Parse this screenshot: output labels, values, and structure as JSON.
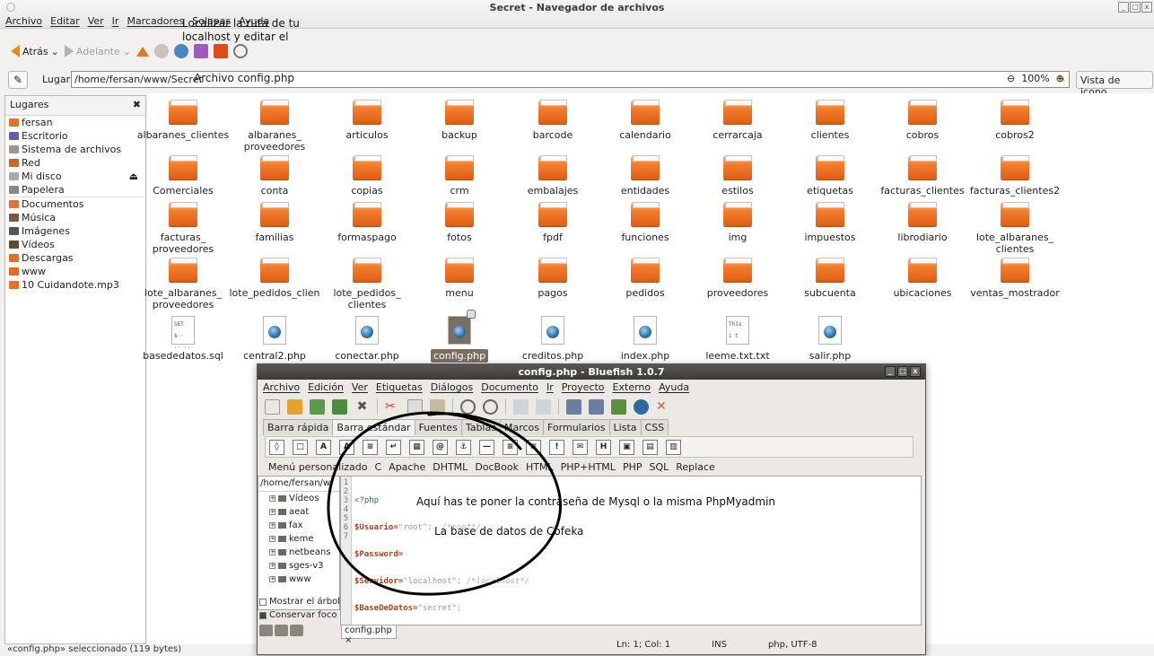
{
  "window": {
    "title": "Secret - Navegador de archivos"
  },
  "menu": [
    "Archivo",
    "Editar",
    "Ver",
    "Ir",
    "Marcadores",
    "Solapas",
    "Ayuda"
  ],
  "toolbar": {
    "back": "Atrás",
    "forward": "Adelante"
  },
  "annotation_top": [
    "Localizar la ruta de tu",
    "localhost y editar el",
    "Archivo config.php"
  ],
  "location": {
    "label": "Lugar:",
    "path": "/home/fersan/www/Secret",
    "zoom": "100%",
    "view": "Vista de icono"
  },
  "sidebar": {
    "header": "Lugares",
    "items": [
      {
        "label": "fersan",
        "color": "#d9772a"
      },
      {
        "label": "Escritorio",
        "color": "#6d5aa8"
      },
      {
        "label": "Sistema de archivos",
        "color": "#9a9894"
      },
      {
        "label": "Red",
        "color": "#c56a2b"
      },
      {
        "label": "Mi disco",
        "color": "#aaaaaa"
      },
      {
        "label": "Papelera",
        "color": "#8a8884"
      },
      {
        "label": "Documentos",
        "color": "#e0733a"
      },
      {
        "label": "Música",
        "color": "#7a5a3a"
      },
      {
        "label": "Imágenes",
        "color": "#555555"
      },
      {
        "label": "Vídeos",
        "color": "#5a4b3c"
      },
      {
        "label": "Descargas",
        "color": "#e2702a"
      },
      {
        "label": "www",
        "color": "#e96a1f"
      },
      {
        "label": "10 Cuidandote.mp3",
        "color": "#e2702a"
      }
    ]
  },
  "files": [
    [
      "albaranes_clientes",
      "albaranes_\nproveedores",
      "articulos",
      "backup",
      "barcode",
      "calendario",
      "cerrarcaja",
      "clientes",
      "cobros",
      "cobros2"
    ],
    [
      "Comerciales",
      "conta",
      "copias",
      "crm",
      "embalajes",
      "entidades",
      "estilos",
      "etiquetas",
      "facturas_clientes",
      "facturas_clientes2"
    ],
    [
      "facturas_\nproveedores",
      "familias",
      "formaspago",
      "fotos",
      "fpdf",
      "funciones",
      "img",
      "impuestos",
      "librodiario",
      "lote_albaranes_\nclientes"
    ],
    [
      "lote_albaranes_\nproveedores",
      "lote_pedidos_clien",
      "lote_pedidos_\nclientes",
      "menu",
      "pagos",
      "pedidos",
      "proveedores",
      "subcuenta",
      "ubicaciones",
      "ventas_mostrador"
    ]
  ],
  "docs": [
    "basededatos.sql",
    "central2.php",
    "conectar.php",
    "config.php",
    "creditos.php",
    "index.php",
    "leeme.txt.txt",
    "salir.php"
  ],
  "status": "«config.php» seleccionado (119 bytes)",
  "bluefish": {
    "title": "config.php - Bluefish 1.0.7",
    "menu": [
      "Archivo",
      "Edición",
      "Ver",
      "Etiquetas",
      "Diálogos",
      "Documento",
      "Ir",
      "Proyecto",
      "Externo",
      "Ayuda"
    ],
    "tabs": [
      "Barra rápida",
      "Barra estándar",
      "Fuentes",
      "Tablas",
      "Marcos",
      "Formularios",
      "Lista",
      "CSS"
    ],
    "custom_menu": [
      "Menú personalizado",
      "C",
      "Apache",
      "DHTML",
      "DocBook",
      "HTML",
      "PHP+HTML",
      "PHP",
      "SQL",
      "Replace"
    ],
    "tree_path": "/home/fersan/w",
    "tree": [
      "Vídeos",
      "aeat",
      "fax",
      "keme",
      "netbeans",
      "sges-v3",
      "www"
    ],
    "options": [
      "Mostrar el árbol",
      "Conservar foco"
    ],
    "gutter": [
      "1",
      "2",
      "3",
      "4",
      "5",
      "6",
      "7"
    ],
    "code": {
      "l1": "<?php",
      "l2_var": "$Usuario=",
      "l2_str": "\"root\";",
      "l2_cm": "/*root*/",
      "l3_var": "$Password=",
      "l4_var": "$Servidor=",
      "l4_str": "\"localhost\";",
      "l4_cm": "/*localhost*/",
      "l5_var": "$BaseDeDatos=",
      "l5_str": "\"secret\";",
      "l6": "?>"
    },
    "doc_tab": "config.php",
    "status_pos": "Ln: 1; Col: 1",
    "status_mode": "INS",
    "status_enc": "php, UTF-8",
    "annot1": "Aquí has te poner la contraseña de  Mysql o la misma PhpMyadmin",
    "annot2": "La base de datos de Cofeka"
  }
}
